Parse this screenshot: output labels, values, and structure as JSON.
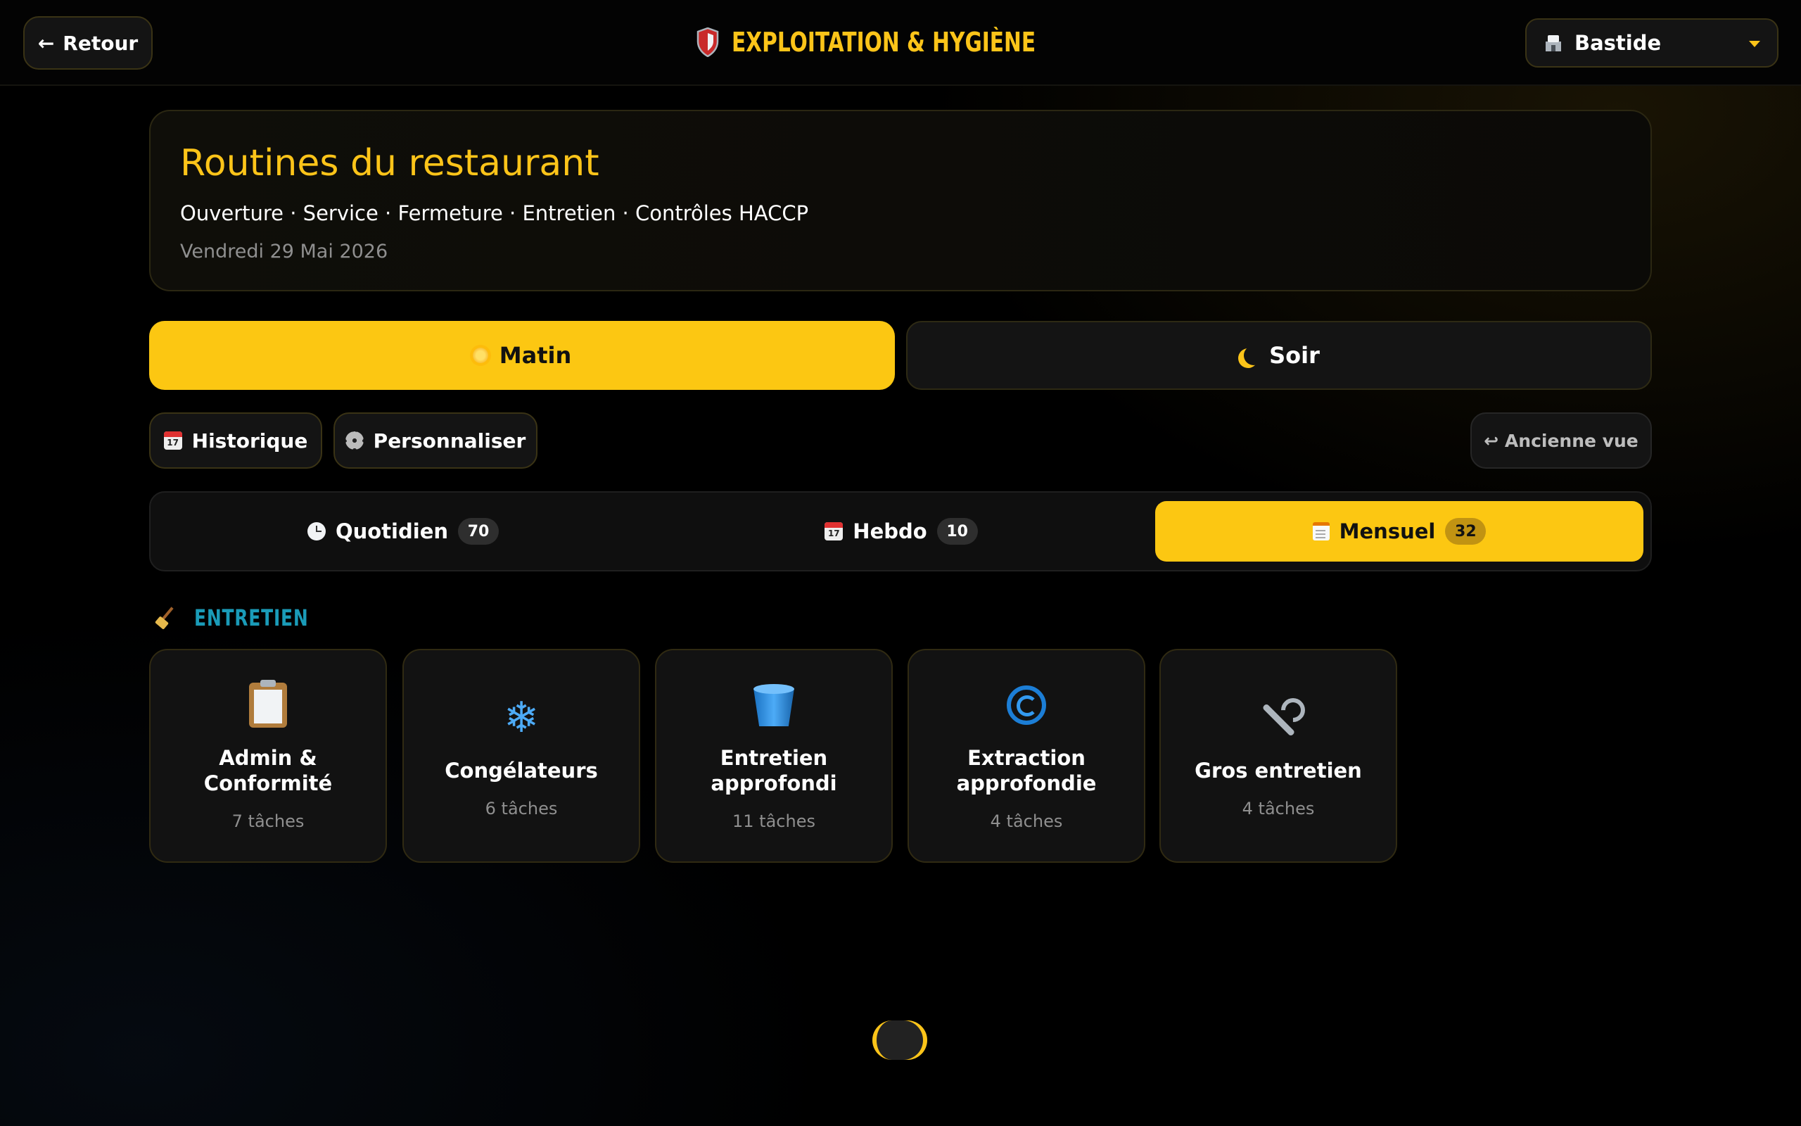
{
  "topbar": {
    "back_label": "Retour",
    "app_title": "EXPLOITATION & HYGIÈNE",
    "site_selected": "Bastide"
  },
  "hero": {
    "title": "Routines du restaurant",
    "subtitle": "Ouverture · Service · Fermeture · Entretien · Contrôles HACCP",
    "date": "Vendredi 29 Mai 2026"
  },
  "shifts": [
    {
      "label": "Matin",
      "icon": "sun-icon",
      "active": true
    },
    {
      "label": "Soir",
      "icon": "moon-icon",
      "active": false
    }
  ],
  "actions": {
    "history_label": "Historique",
    "customize_label": "Personnaliser",
    "old_view_label": "↩ Ancienne vue"
  },
  "frequency_tabs": [
    {
      "label": "Quotidien",
      "count": "70",
      "icon": "clock-icon",
      "active": false
    },
    {
      "label": "Hebdo",
      "count": "10",
      "icon": "calendar-icon",
      "active": false
    },
    {
      "label": "Mensuel",
      "count": "32",
      "icon": "notepad-icon",
      "active": true
    }
  ],
  "section": {
    "title": "ENTRETIEN",
    "icon": "broom-icon"
  },
  "categories": [
    {
      "name": "Admin & Conformité",
      "count": "7 tâches",
      "icon": "clipboard-icon"
    },
    {
      "name": "Congélateurs",
      "count": "6 tâches",
      "icon": "snowflake-icon"
    },
    {
      "name": "Entretien approfondi",
      "count": "11 tâches",
      "icon": "bucket-icon"
    },
    {
      "name": "Extraction approfondie",
      "count": "4 tâches",
      "icon": "spiral-icon"
    },
    {
      "name": "Gros entretien",
      "count": "4 tâches",
      "icon": "wrench-icon"
    }
  ],
  "colors": {
    "accent": "#fcc712",
    "section_title": "#1a9bb8",
    "background": "#000000",
    "card": "#121212"
  }
}
